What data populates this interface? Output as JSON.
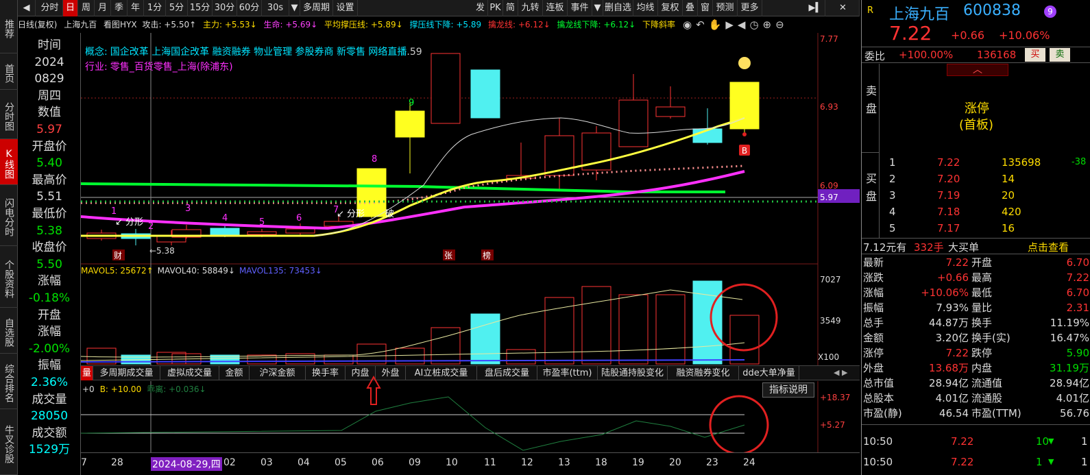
{
  "toolbar": {
    "periods": [
      "分时",
      "日",
      "周",
      "月",
      "季",
      "年",
      "1分",
      "5分",
      "15分",
      "30分",
      "60分",
      "30s",
      "▼",
      "多周期",
      "设置"
    ],
    "right_buttons": [
      "发",
      "PK",
      "简",
      "九转",
      "连板",
      "事件",
      "▼",
      "删自选",
      "均线",
      "复权",
      "叠",
      "窗",
      "预测",
      "更多"
    ]
  },
  "leftnav": [
    "推荐",
    "首页",
    "分时图",
    "K线图",
    "闪电分时",
    "个股资料",
    "自选股",
    "综合排名",
    "牛叉诊股"
  ],
  "infobar": {
    "line_type": "日线(复权)",
    "stock": "上海九百",
    "indicator": "看图HYX",
    "attack": "攻击: +5.50↑",
    "main": "主力: +5.53↓",
    "life": "生命: +5.69↓",
    "avg_support": "平均撑压线: +5.89↓",
    "support_down": "撑压线下降: +5.89",
    "dragon": "擒龙线: +6.12↓",
    "dragon_down": "擒龙线下降: +6.12↓",
    "slope": "下降斜率"
  },
  "datapanel": [
    {
      "t": "时间",
      "c": "lbl"
    },
    {
      "t": "2024",
      "c": "w"
    },
    {
      "t": "0829",
      "c": "w"
    },
    {
      "t": "周四",
      "c": "w"
    },
    {
      "t": "数值",
      "c": "lbl"
    },
    {
      "t": "5.97",
      "c": "r"
    },
    {
      "t": "开盘价",
      "c": "lbl"
    },
    {
      "t": "5.40",
      "c": "g"
    },
    {
      "t": "最高价",
      "c": "lbl"
    },
    {
      "t": "5.51",
      "c": "w"
    },
    {
      "t": "最低价",
      "c": "lbl"
    },
    {
      "t": "5.38",
      "c": "g"
    },
    {
      "t": "收盘价",
      "c": "lbl"
    },
    {
      "t": "5.50",
      "c": "g"
    },
    {
      "t": "涨幅",
      "c": "lbl"
    },
    {
      "t": "-0.18%",
      "c": "g"
    },
    {
      "t": "开盘",
      "c": "lbl"
    },
    {
      "t": "涨幅",
      "c": "lbl"
    },
    {
      "t": "-2.00%",
      "c": "g"
    },
    {
      "t": "振幅",
      "c": "lbl"
    },
    {
      "t": "2.36%",
      "c": "c"
    },
    {
      "t": "成交量",
      "c": "lbl"
    },
    {
      "t": "28050",
      "c": "c"
    },
    {
      "t": "成交额",
      "c": "lbl"
    },
    {
      "t": "1529万",
      "c": "c"
    }
  ],
  "chart": {
    "concept_label": "概念:",
    "concept_text": "国企改革 上海国企改革 融资融券 物业管理 参股券商 新零售 网络直播",
    "concept_tail": ".59",
    "industry_label": "行业:",
    "industry_text": "零售_百货零售_上海(除浦东)",
    "price_axis": [
      "7.77",
      "6.93",
      "6.09",
      "5.97"
    ],
    "vol_axis": [
      "7027",
      "3549",
      "X100"
    ],
    "ind_axis": [
      "+18.37",
      "+5.27"
    ],
    "mavol": {
      "m5": "MAVOL5: 25672↑",
      "m40": "MAVOL40: 58849↓",
      "m135": "MAVOL135: 73453↓"
    },
    "ind_header": {
      "a": "+0",
      "b": "B: +10.00",
      "c": "乖离: +0.036↓"
    },
    "ind_button": "指标说明",
    "labels": {
      "fenxing1": "↙ 分形",
      "fenxing2": "↙ 分形",
      "bo": "破",
      "low": "←5.38",
      "cai": "财",
      "zhang": "张",
      "bang": "榜",
      "B": "B"
    },
    "counts": [
      "1",
      "2",
      "3",
      "4",
      "5",
      "6",
      "7",
      "8",
      "9"
    ],
    "dates": [
      "7",
      "28",
      "2024-08-29,四",
      "02",
      "03",
      "04",
      "05",
      "06",
      "09",
      "10",
      "11",
      "12",
      "13",
      "18",
      "19",
      "20",
      "23",
      "24"
    ]
  },
  "tabs": [
    "量",
    "多周期成交量",
    "虚拟成交量",
    "金额",
    "沪深金额",
    "换手率",
    "内盘",
    "外盘",
    "AI立桩成交量",
    "盘后成交量",
    "市盈率(ttm)",
    "陆股通持股变化",
    "融资融券变化",
    "dde大单净量"
  ],
  "quote": {
    "name": "上海九百",
    "code": "600838",
    "badge": "9",
    "price": "7.22",
    "change": "+0.66",
    "pct": "+10.06%",
    "weibi_label": "委比",
    "weibi": "+100.00%",
    "weicha": "136168",
    "buy_btn": "买",
    "sell_btn": "卖",
    "sell_label": "卖盘",
    "limit_label": "涨停",
    "limit_sub": "(首板)",
    "buy_label": "买盘",
    "bids": [
      {
        "lv": "1",
        "p": "7.22",
        "v": "135698",
        "d": "-38"
      },
      {
        "lv": "2",
        "p": "7.20",
        "v": "14",
        "d": ""
      },
      {
        "lv": "3",
        "p": "7.19",
        "v": "20",
        "d": ""
      },
      {
        "lv": "4",
        "p": "7.18",
        "v": "420",
        "d": ""
      },
      {
        "lv": "5",
        "p": "7.17",
        "v": "16",
        "d": ""
      }
    ],
    "bigorder": {
      "a": "7.12元有",
      "b": "332手",
      "c": "大买单",
      "d": "点击查看"
    },
    "stats": [
      {
        "l1": "最新",
        "v1": "7.22",
        "c1": "red",
        "l2": "开盘",
        "v2": "6.70",
        "c2": "red"
      },
      {
        "l1": "涨跌",
        "v1": "+0.66",
        "c1": "red",
        "l2": "最高",
        "v2": "7.22",
        "c2": "red"
      },
      {
        "l1": "涨幅",
        "v1": "+10.06%",
        "c1": "red",
        "l2": "最低",
        "v2": "6.70",
        "c2": "red"
      },
      {
        "l1": "振幅",
        "v1": "7.93%",
        "c1": "white",
        "l2": "量比",
        "v2": "2.31",
        "c2": "red"
      },
      {
        "l1": "总手",
        "v1": "44.87万",
        "c1": "white",
        "l2": "换手",
        "v2": "11.19%",
        "c2": "white"
      },
      {
        "l1": "金额",
        "v1": "3.20亿",
        "c1": "white",
        "l2": "换手(实)",
        "v2": "16.47%",
        "c2": "white"
      },
      {
        "l1": "涨停",
        "v1": "7.22",
        "c1": "red",
        "l2": "跌停",
        "v2": "5.90",
        "c2": "green"
      },
      {
        "l1": "外盘",
        "v1": "13.68万",
        "c1": "red",
        "l2": "内盘",
        "v2": "31.19万",
        "c2": "green"
      },
      {
        "l1": "总市值",
        "v1": "28.94亿",
        "c1": "white",
        "l2": "流通值",
        "v2": "28.94亿",
        "c2": "white"
      },
      {
        "l1": "总股本",
        "v1": "4.01亿",
        "c1": "white",
        "l2": "流通股",
        "v2": "4.01亿",
        "c2": "white"
      },
      {
        "l1": "市盈(静)",
        "v1": "46.54",
        "c1": "white",
        "l2": "市盈(TTM)",
        "v2": "56.76",
        "c2": "white"
      }
    ],
    "ticks": [
      {
        "t": "10:50",
        "p": "7.22",
        "v": "10",
        "n": "1"
      },
      {
        "t": "10:50",
        "p": "7.22",
        "v": "1",
        "n": "1"
      }
    ]
  },
  "colors": {
    "up": "#ff3333",
    "down": "#00e5ff",
    "ma_white": "#dddddd",
    "ma_yellow": "#ffff40",
    "ma_magenta": "#ff30ff",
    "ma_green": "#00ff30"
  }
}
